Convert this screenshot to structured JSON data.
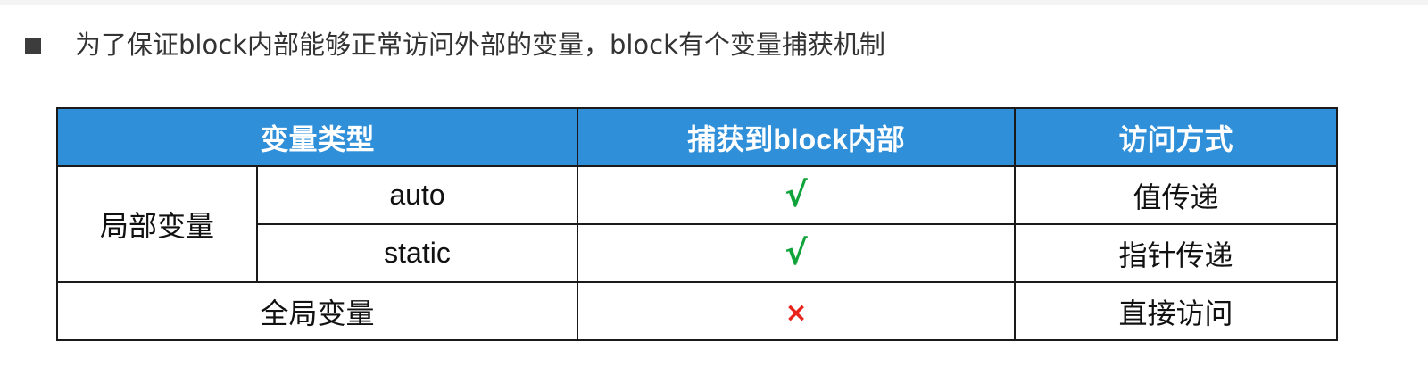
{
  "intro": {
    "bullet_icon": "square-bullet",
    "text": "为了保证block内部能够正常访问外部的变量，block有个变量捕获机制"
  },
  "table": {
    "headers": {
      "type": "变量类型",
      "captured": "捕获到block内部",
      "access": "访问方式"
    },
    "local_group": "局部变量",
    "rows": [
      {
        "subtype": "auto",
        "captured": "√",
        "captured_icon": "check-icon",
        "access": "值传递"
      },
      {
        "subtype": "static",
        "captured": "√",
        "captured_icon": "check-icon",
        "access": "指针传递"
      }
    ],
    "global": {
      "type": "全局变量",
      "captured": "×",
      "captured_icon": "cross-icon",
      "access": "直接访问"
    }
  },
  "colors": {
    "header_bg": "#2f8fd8",
    "check": "#10a33a",
    "cross": "#e8231a"
  }
}
